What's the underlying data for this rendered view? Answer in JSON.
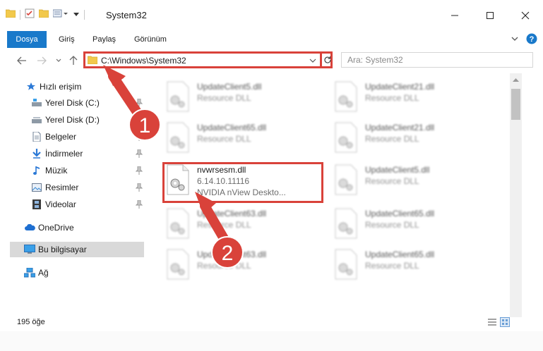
{
  "window": {
    "title": "System32"
  },
  "ribbon": {
    "file_tab": "Dosya",
    "tabs": [
      "Giriş",
      "Paylaş",
      "Görünüm"
    ]
  },
  "navbar": {
    "path": "C:\\Windows\\System32",
    "search_placeholder": "Ara: System32"
  },
  "sidebar": {
    "items": [
      {
        "label": "Hızlı erişim"
      },
      {
        "label": "Yerel Disk (C:)"
      },
      {
        "label": "Yerel Disk (D:)"
      },
      {
        "label": "Belgeler"
      },
      {
        "label": "İndirmeler"
      },
      {
        "label": "Müzik"
      },
      {
        "label": "Resimler"
      },
      {
        "label": "Videolar"
      },
      {
        "label": "OneDrive"
      },
      {
        "label": "Bu bilgisayar"
      },
      {
        "label": "Ağ"
      }
    ]
  },
  "files": [
    {
      "name": "UpdateClient5.dll",
      "desc": "Resource DLL"
    },
    {
      "name": "UpdateClient21.dll",
      "desc": "Resource DLL"
    },
    {
      "name": "UpdateClient65.dll",
      "desc": "Resource DLL"
    },
    {
      "name": "UpdateClient21.dll",
      "desc": "Resource DLL"
    },
    {
      "name": "nvwrsesm.dll",
      "desc": "6.14.10.11116",
      "desc2": "NVIDIA nView Deskto..."
    },
    {
      "name": "UpdateClient5.dll",
      "desc": "Resource DLL"
    },
    {
      "name": "UpdateClient63.dll",
      "desc": "Resource DLL"
    },
    {
      "name": "UpdateClient65.dll",
      "desc": "Resource DLL"
    },
    {
      "name": "UpdateClient63.dll",
      "desc": "Resource DLL"
    },
    {
      "name": "UpdateClient65.dll",
      "desc": "Resource DLL"
    }
  ],
  "status": {
    "count": "195 öğe"
  },
  "annotations": {
    "step1": "1",
    "step2": "2"
  },
  "colors": {
    "accent": "#1979ca",
    "annotation": "#d9423a",
    "selected": "#d9d9d9"
  }
}
